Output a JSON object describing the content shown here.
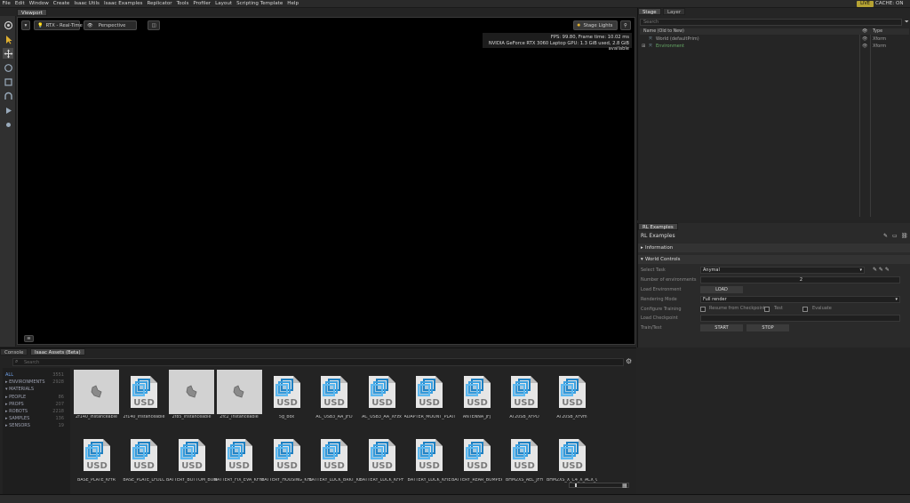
{
  "menu": [
    "File",
    "Edit",
    "Window",
    "Create",
    "Isaac Utils",
    "Isaac Examples",
    "Replicator",
    "Tools",
    "Profiler",
    "Layout",
    "Scripting Template",
    "Help"
  ],
  "status_live": "LIVE",
  "status_cache": "CACHE: ON",
  "viewport": {
    "tab": "Viewport",
    "render_mode": "RTX - Real-Time",
    "camera": "Perspective",
    "stage_lights": "Stage Lights",
    "fps_line": "FPS: 99.80, Frame time: 10.02 ms",
    "gpu_line": "NVIDIA GeForce RTX 3060 Laptop GPU: 1.3 GiB used, 2.8 GiB available"
  },
  "stage": {
    "tabs": [
      "Stage",
      "Layer"
    ],
    "search_placeholder": "Search",
    "col_name": "Name (Old to New)",
    "col_type": "Type",
    "rows": [
      {
        "name": "World (defaultPrim)",
        "type": "Xform"
      },
      {
        "name": "Environment",
        "type": "Xform"
      }
    ]
  },
  "rl": {
    "tab": "RL Examples",
    "title": "RL Examples",
    "info_section": "Information",
    "world_section": "World Controls",
    "select_task_label": "Select Task",
    "select_task_value": "Anymal",
    "num_envs_label": "Number of environments",
    "num_envs_value": "2",
    "load_env_label": "Load Environment",
    "load_btn": "LOAD",
    "render_mode_label": "Rendering Mode",
    "render_mode_value": "Full render",
    "config_label": "Configure Training",
    "resume_label": "Resume from Checkpoint",
    "test_label": "Test",
    "evaluate_label": "Evaluate",
    "load_ckpt_label": "Load Checkpoint",
    "train_label": "Train/Test",
    "start_btn": "START",
    "stop_btn": "STOP"
  },
  "assets": {
    "tabs": [
      "Console",
      "Isaac Assets (Beta)"
    ],
    "search_placeholder": "Search",
    "categories": [
      {
        "label": "ALL",
        "count": "3551"
      },
      {
        "label": "ENVIRONMENTS",
        "count": "2928"
      },
      {
        "label": "MATERIALS",
        "count": ""
      },
      {
        "label": "PEOPLE",
        "count": "86"
      },
      {
        "label": "PROPS",
        "count": "207"
      },
      {
        "label": "ROBOTS",
        "count": "2218"
      },
      {
        "label": "SAMPLES",
        "count": "136"
      },
      {
        "label": "SENSORS",
        "count": "19"
      }
    ],
    "row1": [
      {
        "name": "2f140_instanceable",
        "light": true
      },
      {
        "name": "2f140_instanceable",
        "light": false
      },
      {
        "name": "2f85_instanceable",
        "light": true
      },
      {
        "name": "2fc2_instanceable",
        "light": true
      },
      {
        "name": "5g_box",
        "light": false
      },
      {
        "name": "AC_USB3_AA_JFD",
        "light": false
      },
      {
        "name": "AC_USB3_AA_XFzx",
        "light": false
      },
      {
        "name": "ADAPTER_MOUNT_PLATE_JFv",
        "light": false
      },
      {
        "name": "ANTENNA_JFj",
        "light": false
      },
      {
        "name": "AT20SB_XFPD",
        "light": false
      },
      {
        "name": "AT20SB_XFvm",
        "light": false
      }
    ],
    "row2": [
      {
        "name": "BASE_PLATE_KFfR"
      },
      {
        "name": "BASE_PLATE_LFDLC"
      },
      {
        "name": "BATTERY_BOTTOM_BUMPER_JF7"
      },
      {
        "name": "BATTERY_FIX_EVA_KFnF"
      },
      {
        "name": "BATTERY_HOUSING_KFLO"
      },
      {
        "name": "BATTERY_LOCK_BRKT_KF2FN"
      },
      {
        "name": "BATTERY_LOCK_KFPF"
      },
      {
        "name": "BATTERY_LOCK_KFIE"
      },
      {
        "name": "BATTERY_REAR_BUMPER_KF2FF"
      },
      {
        "name": "BHM2XS_AEL_JFH"
      },
      {
        "name": "BHM2XS_X_C4_X_ACX_C"
      }
    ]
  }
}
